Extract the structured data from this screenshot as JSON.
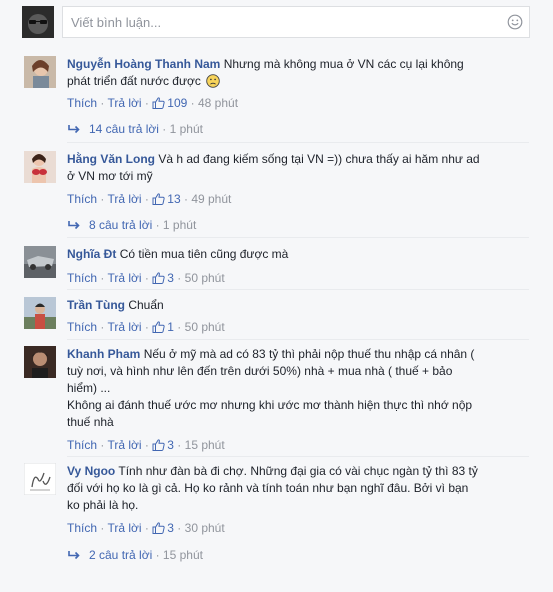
{
  "composer": {
    "placeholder": "Viết bình luận...",
    "icon": "smiley-icon"
  },
  "action_labels": {
    "like": "Thích",
    "reply": "Trả lời",
    "dot": "·"
  },
  "comments": [
    {
      "author": "Nguyễn Hoàng Thanh Nam",
      "line1": "Nhưng mà không mua ở VN các cụ lại không",
      "line2": "phát triển đất nước được",
      "likes": "109",
      "time": "48 phút",
      "replies": "14 câu trả lời",
      "replies_time": "1 phút"
    },
    {
      "author": "Hằng Văn Long",
      "line1": "Và h ad đang kiếm sống tại VN =)) chưa thấy ai hăm như ad",
      "line2": "ở VN mơ tới mỹ",
      "likes": "13",
      "time": "49 phút",
      "replies": "8 câu trả lời",
      "replies_time": "1 phút"
    },
    {
      "author": "Nghĩa Đt",
      "line1": "Có tiền mua tiên cũng được mà",
      "likes": "3",
      "time": "50 phút"
    },
    {
      "author": "Trần Tùng",
      "line1": "Chuẩn",
      "likes": "1",
      "time": "50 phút"
    },
    {
      "author": "Khanh Pham",
      "line1": "Nếu ở mỹ mà ad có 83 tỷ thì phải nộp thuế thu nhập cá nhân (",
      "line2": "tuỳ nơi, và hình như lên đến trên dưới 50%) nhà + mua nhà ( thuế + bảo",
      "line3": "hiểm) ...",
      "line4": "Không ai đánh thuế ước mơ nhưng khi ước mơ thành hiện thực thì nhớ nộp",
      "line5": "thuế nhà",
      "likes": "3",
      "time": "15 phút"
    },
    {
      "author": "Vy Ngoo",
      "line1": "Tính như đàn bà đi chợ. Những đại gia có vài chục ngàn tỷ thì 83 tỷ",
      "line2": "đối với họ ko là gì cả. Họ ko rảnh và tính toán như bạn nghĩ đâu. Bởi vì bạn",
      "line3": "ko phải là họ.",
      "likes": "3",
      "time": "30 phút",
      "replies": "2 câu trả lời",
      "replies_time": "15 phút"
    }
  ]
}
